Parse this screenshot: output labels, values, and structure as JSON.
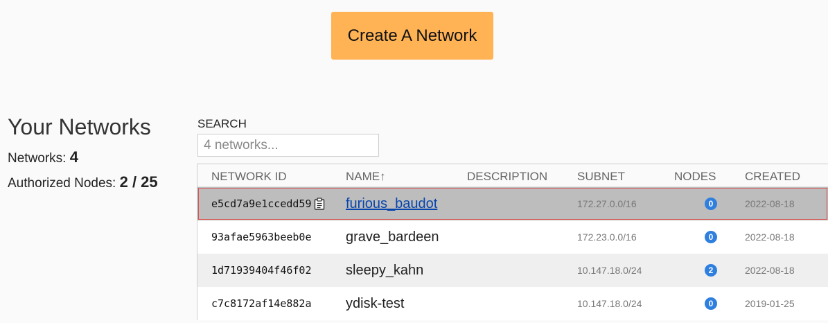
{
  "create_button": "Create A Network",
  "summary": {
    "title": "Your Networks",
    "networks_label": "Networks:",
    "networks_count": "4",
    "nodes_label": "Authorized Nodes:",
    "nodes_value": "2 / 25"
  },
  "search": {
    "label": "SEARCH",
    "placeholder": "4 networks..."
  },
  "table": {
    "columns": [
      "NETWORK ID",
      "NAME↑",
      "DESCRIPTION",
      "SUBNET",
      "NODES",
      "CREATED"
    ],
    "rows": [
      {
        "id": "e5cd7a9e1ccedd59",
        "name": "furious_baudot",
        "subnet": "172.27.0.0/16",
        "nodes": "0",
        "created": "2022-08-18"
      },
      {
        "id": "93afae5963beeb0e",
        "name": "grave_bardeen",
        "subnet": "172.23.0.0/16",
        "nodes": "0",
        "created": "2022-08-18"
      },
      {
        "id": "1d71939404f46f02",
        "name": "sleepy_kahn",
        "subnet": "10.147.18.0/24",
        "nodes": "2",
        "created": "2022-08-18"
      },
      {
        "id": "c7c8172af14e882a",
        "name": "ydisk-test",
        "subnet": "10.147.18.0/24",
        "nodes": "0",
        "created": "2019-01-25"
      }
    ],
    "selected_row": 0
  },
  "icons": {
    "copy": "clipboard-icon"
  },
  "colors": {
    "button": "#ffb355",
    "badge": "#2f7fdf",
    "selected_row": "#bdbdbd",
    "selected_outline": "#d9534f",
    "link": "#0645ad"
  }
}
